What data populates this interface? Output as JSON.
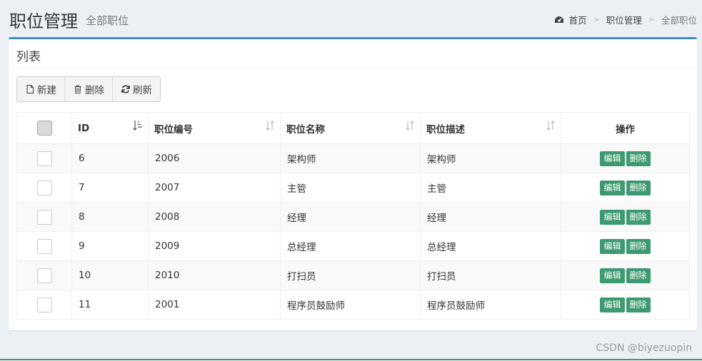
{
  "header": {
    "title": "职位管理",
    "subtitle": "全部职位",
    "breadcrumb": {
      "home": "首页",
      "section": "职位管理",
      "current": "全部职位",
      "separator": ">"
    }
  },
  "box": {
    "title": "列表"
  },
  "toolbar": {
    "new_label": "新建",
    "delete_label": "删除",
    "refresh_label": "刷新"
  },
  "table": {
    "columns": {
      "id": "ID",
      "code": "职位编号",
      "name": "职位名称",
      "desc": "职位描述",
      "ops": "操作"
    },
    "edit_label": "编辑",
    "delete_label": "删除",
    "rows": [
      {
        "id": "6",
        "code": "2006",
        "name": "架构师",
        "desc": "架构师"
      },
      {
        "id": "7",
        "code": "2007",
        "name": "主管",
        "desc": "主管"
      },
      {
        "id": "8",
        "code": "2008",
        "name": "经理",
        "desc": "经理"
      },
      {
        "id": "9",
        "code": "2009",
        "name": "总经理",
        "desc": "总经理"
      },
      {
        "id": "10",
        "code": "2010",
        "name": "打扫员",
        "desc": "打扫员"
      },
      {
        "id": "11",
        "code": "2001",
        "name": "程序员鼓励师",
        "desc": "程序员鼓励师"
      }
    ]
  },
  "watermark": "CSDN @biyezuopin",
  "colors": {
    "accent": "#3c8dbc",
    "action_green": "#3d9970",
    "background": "#ecf0f5"
  },
  "icons": {
    "breadcrumb_home": "dashboard-icon",
    "new": "file-icon",
    "delete": "trash-icon",
    "refresh": "refresh-icon",
    "sort_active": "sort-amount-icon",
    "sort": "sort-icon"
  }
}
